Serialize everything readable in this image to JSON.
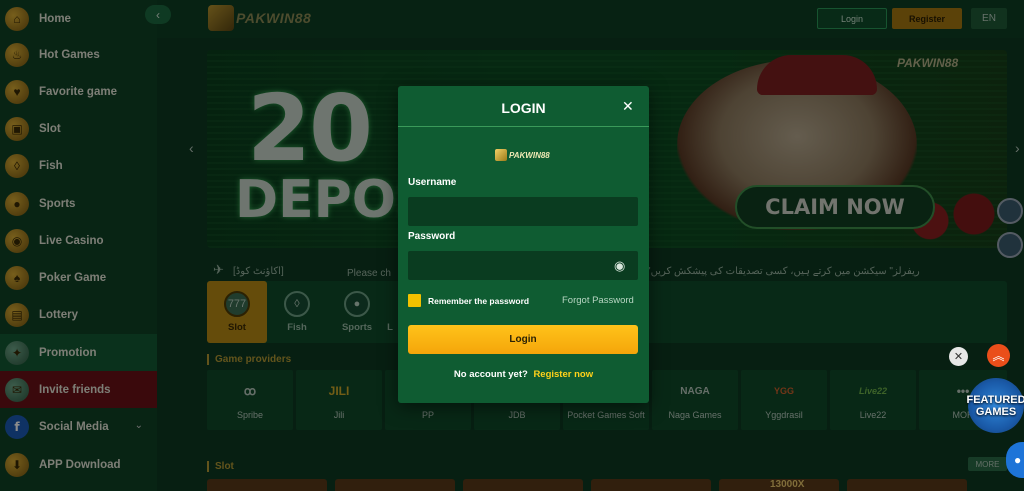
{
  "sidebar": {
    "items": [
      {
        "label": "Home",
        "icon": "home-icon"
      },
      {
        "label": "Hot Games",
        "icon": "fire-icon"
      },
      {
        "label": "Favorite game",
        "icon": "heart-icon"
      },
      {
        "label": "Slot",
        "icon": "slot-machine-icon"
      },
      {
        "label": "Fish",
        "icon": "fish-icon"
      },
      {
        "label": "Sports",
        "icon": "ball-icon"
      },
      {
        "label": "Live Casino",
        "icon": "casino-icon"
      },
      {
        "label": "Poker Game",
        "icon": "poker-icon"
      },
      {
        "label": "Lottery",
        "icon": "lottery-icon"
      },
      {
        "label": "Promotion",
        "icon": "gift-icon"
      },
      {
        "label": "Invite friends",
        "icon": "invite-icon"
      },
      {
        "label": "Social Media",
        "icon": "facebook-icon"
      },
      {
        "label": "APP Download",
        "icon": "download-icon"
      }
    ]
  },
  "header": {
    "logo_text": "PAKWIN88",
    "login_label": "Login",
    "register_label": "Register",
    "lang_label": "EN"
  },
  "banner": {
    "big_number": "20",
    "deposit_text": "DEPOS",
    "claim_label": "CLAIM NOW",
    "logo_text": "PAKWIN88"
  },
  "marquee": {
    "rtl_text": "[اکاؤنٹ کوڈ]",
    "main_text": "Please ch",
    "right_text": "\"ریفرلز\" سیکشن میں کرتے ہیں، کسی تصدیقات کی پیشکش کریں"
  },
  "categories": [
    {
      "label": "Slot",
      "icon": "slot-icon"
    },
    {
      "label": "Fish",
      "icon": "fish-icon"
    },
    {
      "label": "Sports",
      "icon": "sports-icon"
    },
    {
      "label": "L",
      "icon": "live-icon"
    }
  ],
  "sections": {
    "providers_title": "Game providers",
    "slot_title": "Slot",
    "more_label": "MORE"
  },
  "providers": [
    {
      "name": "Spribe",
      "logo": "ꝏ"
    },
    {
      "name": "Jili",
      "logo": "JILI"
    },
    {
      "name": "PP",
      "logo": ""
    },
    {
      "name": "JDB",
      "logo": ""
    },
    {
      "name": "Pocket Games Soft",
      "logo": ""
    },
    {
      "name": "Naga Games",
      "logo": "NAGA"
    },
    {
      "name": "Yggdrasil",
      "logo": "YGG"
    },
    {
      "name": "Live22",
      "logo": "Live22"
    },
    {
      "name": "MOR",
      "logo": "•••"
    }
  ],
  "slot_badge": "13000X",
  "widgets": {
    "featured_line1": "FEATURED",
    "featured_line2": "GAMES"
  },
  "modal": {
    "title": "LOGIN",
    "logo_text": "PAKWIN88",
    "username_label": "Username",
    "username_value": "",
    "password_label": "Password",
    "password_value": "",
    "remember_label": "Remember the password",
    "forgot_label": "Forgot Password",
    "login_button": "Login",
    "no_account_text": "No account yet?",
    "register_link": "Register now"
  },
  "colors": {
    "accent_gold": "#f5a50a",
    "modal_green": "#0f5c32",
    "invite_red": "#6b1216"
  }
}
